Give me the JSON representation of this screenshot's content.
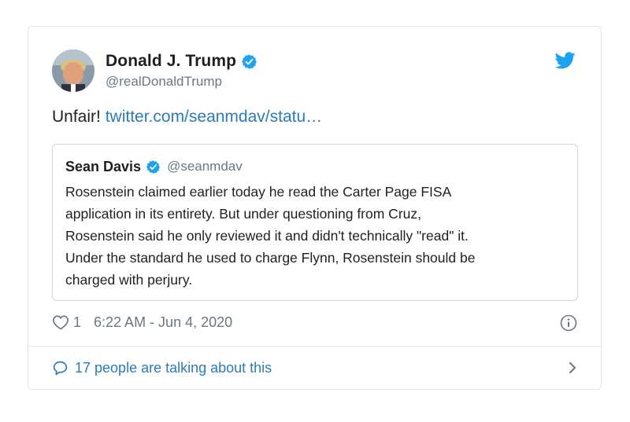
{
  "tweet": {
    "author": {
      "display_name": "Donald J. Trump",
      "handle": "@realDonaldTrump",
      "verified_icon": "verified-badge-icon",
      "avatar": "profile-photo"
    },
    "text_prefix": "Unfair!",
    "link_text": "twitter.com/seanmdav/statu…",
    "quoted": {
      "display_name": "Sean Davis",
      "handle": "@seanmdav",
      "text": "Rosenstein claimed earlier today he read the Carter Page FISA\napplication in its entirety. But under questioning from Cruz,\nRosenstein said he only reviewed it and didn't technically \"read\" it.\nUnder the standard he used to charge Flynn, Rosenstein should be\ncharged with perjury."
    },
    "likes": "1",
    "timestamp": "6:22 AM - Jun 4, 2020",
    "footer_text": "17 people are talking about this"
  },
  "colors": {
    "link": "#2b7bb9",
    "twitter_blue": "#1da1f2",
    "muted": "#697882",
    "border": "#e1e8ed"
  }
}
